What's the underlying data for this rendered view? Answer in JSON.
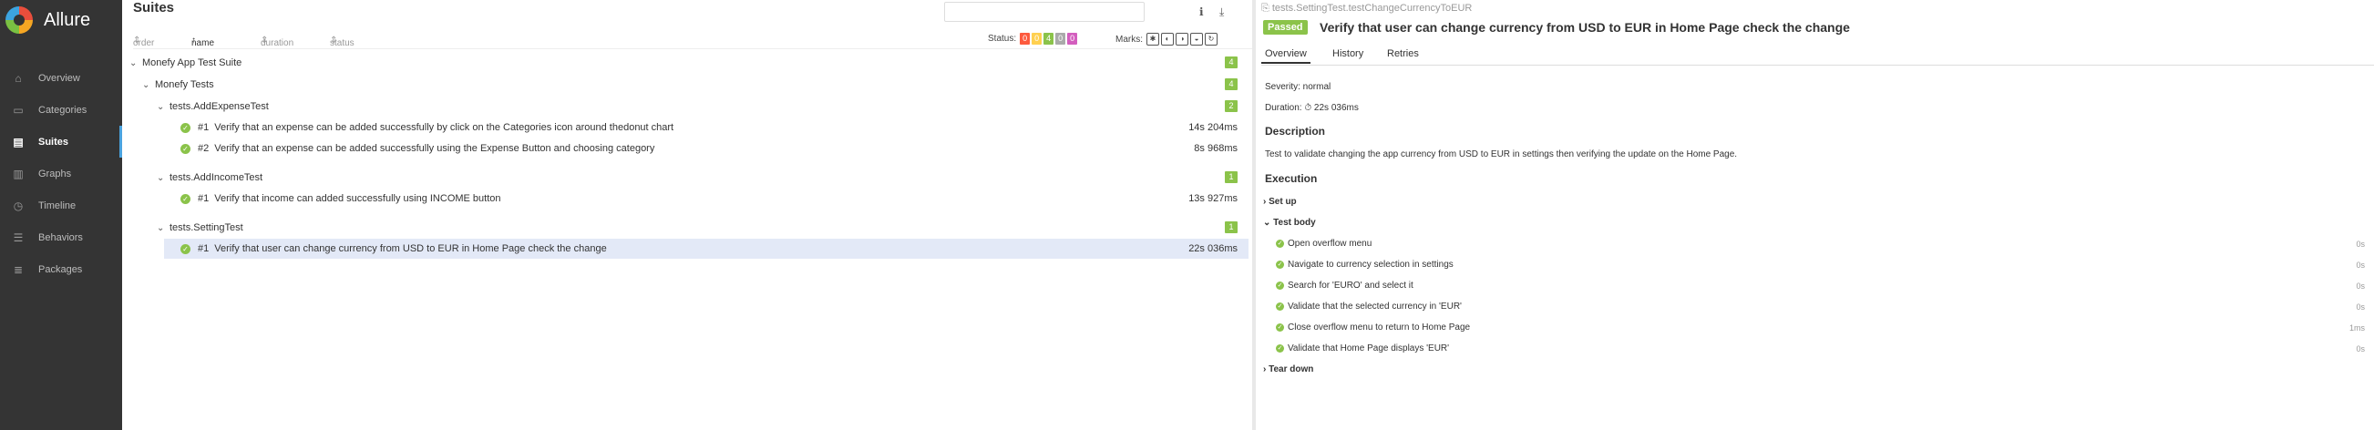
{
  "app": {
    "name": "Allure"
  },
  "sidebar": {
    "items": [
      {
        "label": "Overview",
        "icon": "home-icon"
      },
      {
        "label": "Categories",
        "icon": "briefcase-icon"
      },
      {
        "label": "Suites",
        "icon": "suites-icon"
      },
      {
        "label": "Graphs",
        "icon": "bar-chart-icon"
      },
      {
        "label": "Timeline",
        "icon": "clock-icon"
      },
      {
        "label": "Behaviors",
        "icon": "list-icon"
      },
      {
        "label": "Packages",
        "icon": "packages-icon"
      }
    ],
    "active": "Suites"
  },
  "main": {
    "title": "Suites",
    "search_placeholder": "",
    "sort": {
      "order": "order",
      "name": "name",
      "duration": "duration",
      "status": "status"
    },
    "status_label": "Status:",
    "status_counts": [
      "0",
      "0",
      "4",
      "0",
      "0"
    ],
    "marks_label": "Marks:",
    "tree": {
      "suite": "Monefy App Test Suite",
      "suite_count": "4",
      "group": "Monefy Tests",
      "group_count": "4",
      "c1": "tests.AddExpenseTest",
      "c1_count": "2",
      "c1_t1_num": "#1",
      "c1_t1": "Verify that an expense can be added successfully by click on the Categories icon around thedonut chart",
      "c1_t1_dur": "14s 204ms",
      "c1_t2_num": "#2",
      "c1_t2": "Verify that an expense can be added successfully using the Expense Button and choosing category",
      "c1_t2_dur": "8s 968ms",
      "c2": "tests.AddIncomeTest",
      "c2_count": "1",
      "c2_t1_num": "#1",
      "c2_t1": "Verify that income can added successfully using INCOME button",
      "c2_t1_dur": "13s 927ms",
      "c3": "tests.SettingTest",
      "c3_count": "1",
      "c3_t1_num": "#1",
      "c3_t1": "Verify that user can change currency from USD to EUR in Home Page check the change",
      "c3_t1_dur": "22s 036ms"
    }
  },
  "detail": {
    "path": "tests.SettingTest.testChangeCurrencyToEUR",
    "status": "Passed",
    "title": "Verify that user can change currency from USD to EUR in Home Page check the change",
    "tabs": [
      "Overview",
      "History",
      "Retries"
    ],
    "severity": "Severity: normal",
    "duration": "Duration: ⏱ 22s 036ms",
    "desc_h": "Description",
    "desc": "Test to validate changing the app currency from USD to EUR in settings then verifying the update on the Home Page.",
    "exec_h": "Execution",
    "setup": "Set up",
    "body": "Test body",
    "teardown": "Tear down",
    "steps": [
      {
        "label": "Open overflow menu",
        "dur": "0s"
      },
      {
        "label": "Navigate to currency selection in settings",
        "dur": "0s"
      },
      {
        "label": "Search for 'EURO' and select it",
        "dur": "0s"
      },
      {
        "label": "Validate that the selected currency in 'EUR'",
        "dur": "0s"
      },
      {
        "label": "Close overflow menu to return to Home Page",
        "dur": "1ms"
      },
      {
        "label": "Validate that Home Page displays 'EUR'",
        "dur": "0s"
      }
    ]
  },
  "colors": {
    "passed": "#8bc34a",
    "failed": "#fd5a3e",
    "broken": "#ffd050",
    "skipped": "#aaaaaa",
    "unknown": "#d35ebe",
    "sidebar": "#343434"
  }
}
